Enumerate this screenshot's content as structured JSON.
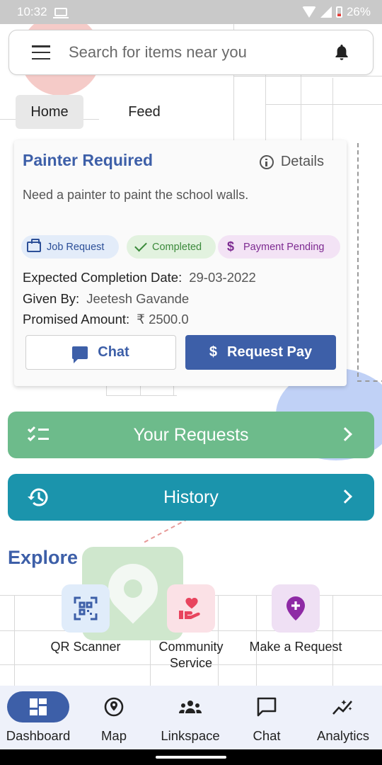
{
  "status_bar": {
    "time": "10:32",
    "battery": "26%"
  },
  "search": {
    "placeholder": "Search for items near you"
  },
  "tabs": [
    {
      "label": "Home"
    },
    {
      "label": "Feed"
    }
  ],
  "request_card": {
    "title": "Painter Required",
    "details_label": "Details",
    "description": "Need a painter to paint the school walls.",
    "chips": [
      {
        "label": "Job Request",
        "icon": "briefcase-icon"
      },
      {
        "label": "Completed",
        "icon": "check-icon"
      },
      {
        "label": "Payment Pending",
        "icon": "dollar-icon"
      }
    ],
    "completion_date_label": "Expected Completion Date:",
    "completion_date_value": "29-03-2022",
    "given_by_label": "Given By:",
    "given_by_value": "Jeetesh Gavande",
    "amount_label": "Promised Amount:",
    "amount_value": "₹ 2500.0",
    "chat_button": "Chat",
    "pay_button": "Request Pay",
    "pay_symbol": "$"
  },
  "actions": {
    "requests_label": "Your Requests",
    "history_label": "History"
  },
  "explore": {
    "title": "Explore",
    "items": [
      {
        "label": "QR Scanner",
        "icon": "qr-icon"
      },
      {
        "label": "Community Service",
        "icon": "volunteer-icon"
      },
      {
        "label": "Make a Request",
        "icon": "add-location-icon"
      }
    ]
  },
  "nav": {
    "items": [
      {
        "label": "Dashboard",
        "icon": "dashboard-icon",
        "active": true
      },
      {
        "label": "Map",
        "icon": "map-pin-icon"
      },
      {
        "label": "Linkspace",
        "icon": "group-icon"
      },
      {
        "label": "Chat",
        "icon": "chat-bubble-icon"
      },
      {
        "label": "Analytics",
        "icon": "analytics-icon"
      }
    ]
  },
  "colors": {
    "primary": "#3d5fa8",
    "requests_bar": "#6dbb8b",
    "history_bar": "#1b94ac",
    "nav_bg": "#eef1fa"
  }
}
